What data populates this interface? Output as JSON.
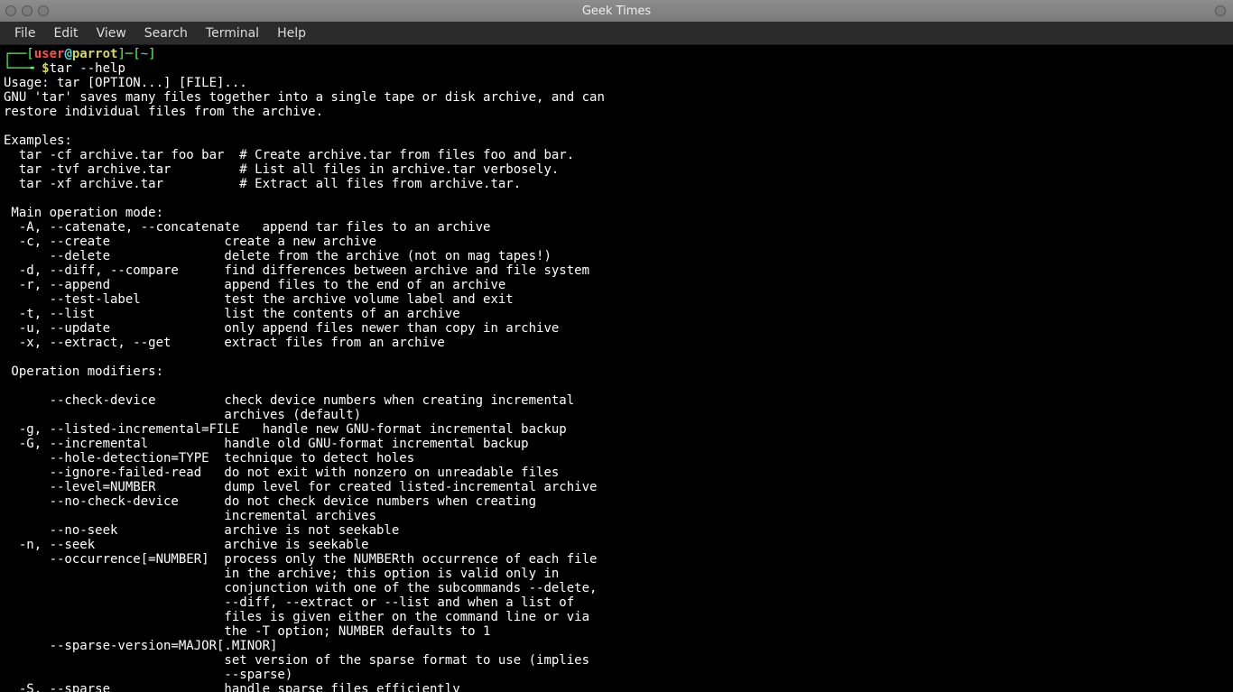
{
  "window": {
    "title": "Geek Times"
  },
  "menubar": {
    "items": [
      "File",
      "Edit",
      "View",
      "Search",
      "Terminal",
      "Help"
    ]
  },
  "prompt": {
    "box_open": "┌──[",
    "user": "user",
    "at": "@",
    "host": "parrot",
    "box_mid": "]─[",
    "cwd": "~",
    "box_close": "]",
    "line2_prefix": "└──╼ ",
    "dollar": "$",
    "command": "tar --help"
  },
  "output": "Usage: tar [OPTION...] [FILE]...\nGNU 'tar' saves many files together into a single tape or disk archive, and can\nrestore individual files from the archive.\n\nExamples:\n  tar -cf archive.tar foo bar  # Create archive.tar from files foo and bar.\n  tar -tvf archive.tar         # List all files in archive.tar verbosely.\n  tar -xf archive.tar          # Extract all files from archive.tar.\n\n Main operation mode:\n  -A, --catenate, --concatenate   append tar files to an archive\n  -c, --create               create a new archive\n      --delete               delete from the archive (not on mag tapes!)\n  -d, --diff, --compare      find differences between archive and file system\n  -r, --append               append files to the end of an archive\n      --test-label           test the archive volume label and exit\n  -t, --list                 list the contents of an archive\n  -u, --update               only append files newer than copy in archive\n  -x, --extract, --get       extract files from an archive\n\n Operation modifiers:\n\n      --check-device         check device numbers when creating incremental\n                             archives (default)\n  -g, --listed-incremental=FILE   handle new GNU-format incremental backup\n  -G, --incremental          handle old GNU-format incremental backup\n      --hole-detection=TYPE  technique to detect holes\n      --ignore-failed-read   do not exit with nonzero on unreadable files\n      --level=NUMBER         dump level for created listed-incremental archive\n      --no-check-device      do not check device numbers when creating\n                             incremental archives\n      --no-seek              archive is not seekable\n  -n, --seek                 archive is seekable\n      --occurrence[=NUMBER]  process only the NUMBERth occurrence of each file\n                             in the archive; this option is valid only in\n                             conjunction with one of the subcommands --delete,\n                             --diff, --extract or --list and when a list of\n                             files is given either on the command line or via\n                             the -T option; NUMBER defaults to 1\n      --sparse-version=MAJOR[.MINOR]\n                             set version of the sparse format to use (implies\n                             --sparse)\n  -S, --sparse               handle sparse files efficiently"
}
